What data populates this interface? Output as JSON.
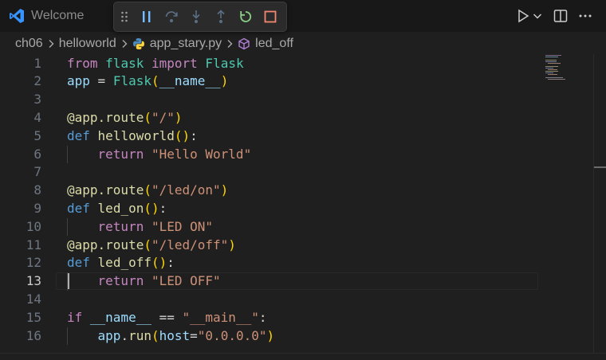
{
  "tab": {
    "label": "Welcome"
  },
  "breadcrumb": {
    "segments": [
      "ch06",
      "helloworld",
      "app_stary.py",
      "led_off"
    ]
  },
  "editor": {
    "active_line": 13,
    "lines": [
      {
        "n": "1",
        "tokens": [
          {
            "t": "from",
            "c": "kw-purple"
          },
          {
            "t": " "
          },
          {
            "t": "flask",
            "c": "cls"
          },
          {
            "t": " "
          },
          {
            "t": "import",
            "c": "kw-purple"
          },
          {
            "t": " "
          },
          {
            "t": "Flask",
            "c": "cls"
          }
        ]
      },
      {
        "n": "2",
        "tokens": [
          {
            "t": "app",
            "c": "ident"
          },
          {
            "t": " = ",
            "c": "plain"
          },
          {
            "t": "Flask",
            "c": "cls"
          },
          {
            "t": "(",
            "c": "paren"
          },
          {
            "t": "__name__",
            "c": "ident"
          },
          {
            "t": ")",
            "c": "paren"
          }
        ]
      },
      {
        "n": "3",
        "tokens": []
      },
      {
        "n": "4",
        "tokens": [
          {
            "t": "@app.route",
            "c": "fn"
          },
          {
            "t": "(",
            "c": "paren"
          },
          {
            "t": "\"/\"",
            "c": "str"
          },
          {
            "t": ")",
            "c": "paren"
          }
        ]
      },
      {
        "n": "5",
        "tokens": [
          {
            "t": "def",
            "c": "kw-blue"
          },
          {
            "t": " "
          },
          {
            "t": "helloworld",
            "c": "fn"
          },
          {
            "t": "()",
            "c": "paren"
          },
          {
            "t": ":",
            "c": "plain"
          }
        ]
      },
      {
        "n": "6",
        "indent": true,
        "tokens": [
          {
            "t": "    "
          },
          {
            "t": "return",
            "c": "kw-purple"
          },
          {
            "t": " "
          },
          {
            "t": "\"Hello World\"",
            "c": "str"
          }
        ]
      },
      {
        "n": "7",
        "tokens": []
      },
      {
        "n": "8",
        "tokens": [
          {
            "t": "@app.route",
            "c": "fn"
          },
          {
            "t": "(",
            "c": "paren"
          },
          {
            "t": "\"/led/on\"",
            "c": "str"
          },
          {
            "t": ")",
            "c": "paren"
          }
        ]
      },
      {
        "n": "9",
        "tokens": [
          {
            "t": "def",
            "c": "kw-blue"
          },
          {
            "t": " "
          },
          {
            "t": "led_on",
            "c": "fn"
          },
          {
            "t": "()",
            "c": "paren"
          },
          {
            "t": ":",
            "c": "plain"
          }
        ]
      },
      {
        "n": "10",
        "indent": true,
        "tokens": [
          {
            "t": "    "
          },
          {
            "t": "return",
            "c": "kw-purple"
          },
          {
            "t": " "
          },
          {
            "t": "\"LED ON\"",
            "c": "str"
          }
        ]
      },
      {
        "n": "11",
        "tokens": [
          {
            "t": "@app.route",
            "c": "fn"
          },
          {
            "t": "(",
            "c": "paren"
          },
          {
            "t": "\"/led/off\"",
            "c": "str"
          },
          {
            "t": ")",
            "c": "paren"
          }
        ]
      },
      {
        "n": "12",
        "tokens": [
          {
            "t": "def",
            "c": "kw-blue"
          },
          {
            "t": " "
          },
          {
            "t": "led_off",
            "c": "fn"
          },
          {
            "t": "()",
            "c": "paren"
          },
          {
            "t": ":",
            "c": "plain"
          }
        ]
      },
      {
        "n": "13",
        "indent": true,
        "tokens": [
          {
            "t": "    "
          },
          {
            "t": "return",
            "c": "kw-purple"
          },
          {
            "t": " "
          },
          {
            "t": "\"LED OFF\"",
            "c": "str"
          }
        ]
      },
      {
        "n": "14",
        "tokens": []
      },
      {
        "n": "15",
        "tokens": [
          {
            "t": "if",
            "c": "kw-purple"
          },
          {
            "t": " "
          },
          {
            "t": "__name__",
            "c": "ident"
          },
          {
            "t": " == ",
            "c": "plain"
          },
          {
            "t": "\"__main__\"",
            "c": "str"
          },
          {
            "t": ":",
            "c": "plain"
          }
        ]
      },
      {
        "n": "16",
        "indent": true,
        "tokens": [
          {
            "t": "    "
          },
          {
            "t": "app",
            "c": "ident"
          },
          {
            "t": ".",
            "c": "plain"
          },
          {
            "t": "run",
            "c": "fn"
          },
          {
            "t": "(",
            "c": "paren"
          },
          {
            "t": "host",
            "c": "ident"
          },
          {
            "t": "=",
            "c": "plain"
          },
          {
            "t": "\"0.0.0.0\"",
            "c": "str"
          },
          {
            "t": ")",
            "c": "paren"
          }
        ]
      }
    ]
  },
  "colors": {
    "background": "#1f1f1f",
    "tabbar": "#181818",
    "accent_blue": "#3794ff",
    "restart_green": "#89d185",
    "stop_red": "#f48771"
  },
  "icons": {
    "tab": "vscode-logo-icon",
    "debug_toolbar": [
      "drag-handle-icon",
      "pause-icon",
      "step-over-icon",
      "step-into-icon",
      "step-out-icon",
      "restart-icon",
      "stop-icon"
    ],
    "title_actions": [
      "run-icon",
      "chevron-down-icon",
      "split-editor-icon",
      "more-actions-icon"
    ],
    "breadcrumb": [
      "chevron-right-icon",
      "python-file-icon",
      "symbol-method-icon"
    ]
  }
}
